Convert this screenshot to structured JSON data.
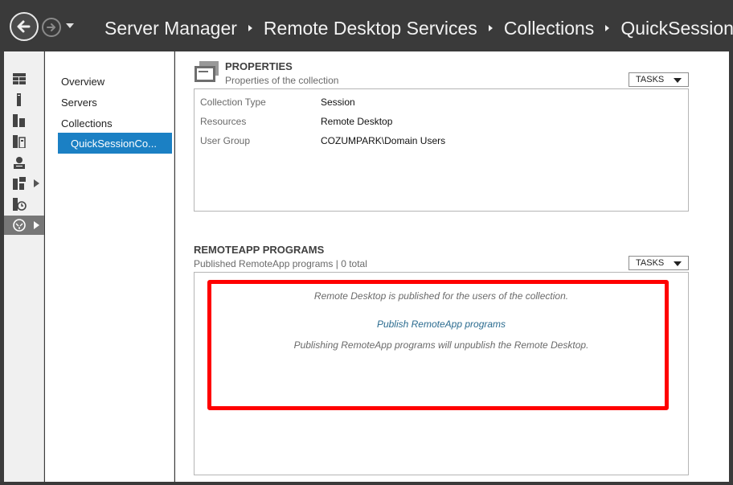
{
  "window": {
    "breadcrumb": [
      "Server Manager",
      "Remote Desktop Services",
      "Collections",
      "QuickSessionColl"
    ]
  },
  "subnav": {
    "items": [
      "Overview",
      "Servers",
      "Collections"
    ],
    "selected": "QuickSessionCo..."
  },
  "properties": {
    "title": "PROPERTIES",
    "subtitle": "Properties of the collection",
    "tasks_label": "TASKS",
    "rows": [
      {
        "label": "Collection Type",
        "value": "Session"
      },
      {
        "label": "Resources",
        "value": "Remote Desktop"
      },
      {
        "label": "User Group",
        "value": "COZUMPARK\\Domain Users"
      }
    ]
  },
  "remoteapp": {
    "title": "REMOTEAPP PROGRAMS",
    "subtitle": "Published RemoteApp programs | 0 total",
    "tasks_label": "TASKS",
    "message": "Remote Desktop is published for the users of the collection.",
    "link": "Publish RemoteApp programs",
    "warning": "Publishing RemoteApp programs will unpublish the Remote Desktop."
  },
  "colors": {
    "accent": "#1b80c4",
    "highlight": "#ff0000",
    "titlebar": "#3a3a3a"
  },
  "icons": [
    "back-arrow-icon",
    "forward-arrow-icon",
    "dropdown-icon",
    "dashboard-icon",
    "local-server-icon",
    "all-servers-icon",
    "file-storage-icon",
    "ad-ds-icon",
    "rds-icon",
    "iis-icon",
    "collections-icon",
    "properties-icon"
  ]
}
